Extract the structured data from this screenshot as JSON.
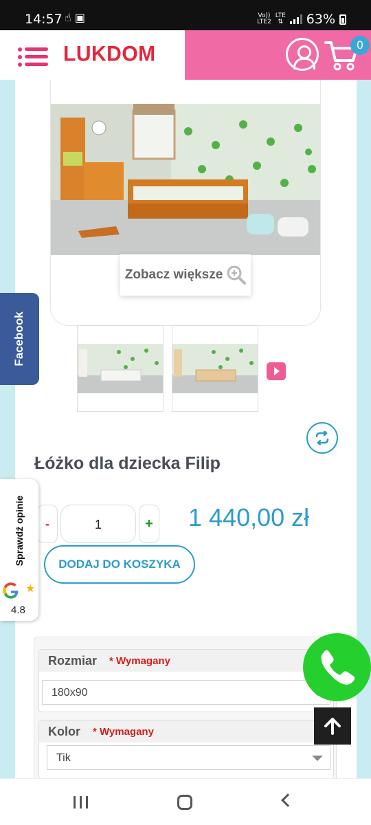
{
  "status_bar": {
    "time": "14:57",
    "volte": "Vo))\nLTE2",
    "network": "LTE",
    "battery": "63%"
  },
  "header": {
    "logo": "LUKDOM",
    "cart_count": "0"
  },
  "gallery": {
    "zoom_label": "Zobacz większe"
  },
  "product": {
    "title": "Łóżko dla dziecka Filip",
    "quantity": "1",
    "qty_minus": "-",
    "qty_plus": "+",
    "price": "1 440,00 zł",
    "add_to_cart": "DODAJ DO KOSZYKA"
  },
  "options": [
    {
      "label": "Rozmiar",
      "required": "* Wymagany",
      "value": "180x90"
    },
    {
      "label": "Kolor",
      "required": "* Wymagany",
      "value": "Tik"
    }
  ],
  "floating": {
    "facebook": "Facebook",
    "reviews_label": "Sprawdź opinie",
    "reviews_star": "★",
    "reviews_score": "4.8"
  },
  "colors": {
    "accent_blue": "#2a9ccc",
    "brand_pink": "#f06aa6",
    "logo_red": "#e8243a",
    "whatsapp_green": "#25cf2e"
  },
  "icons": [
    "menu-icon",
    "user-icon",
    "cart-icon",
    "zoom-icon",
    "next-arrow-icon",
    "refresh-icon",
    "google-icon",
    "star-icon",
    "phone-icon",
    "arrow-up-icon"
  ]
}
